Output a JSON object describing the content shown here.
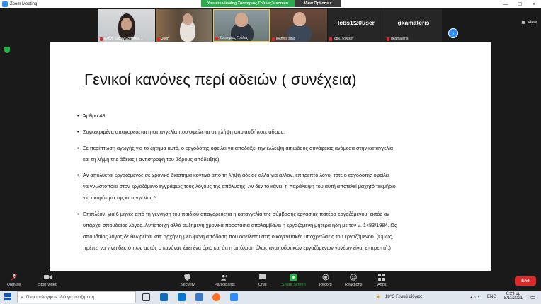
{
  "window": {
    "title": "Zoom Meeting"
  },
  "banner": {
    "viewing": "You are viewing Συστηριος Γούλας's screen",
    "view_options": "View Options"
  },
  "gallery": {
    "view_label": "View",
    "participants": [
      {
        "name": "Ελένη Ευαγγελοπούλο..."
      },
      {
        "name": "John"
      },
      {
        "name": "Συστηριος Γούλας"
      },
      {
        "name": "ioannis sinis"
      },
      {
        "name": "lcbs1!20user",
        "big": "lcbs1!20user"
      },
      {
        "name": "gkamateris",
        "big": "gkamateris"
      }
    ]
  },
  "slide": {
    "title": "Γενικοί κανόνες περί αδειών ( συνέχεια)",
    "bullets": [
      [
        "Άρθρο 48 :"
      ],
      [
        "Συγκεκριμένα απαγορεύεται η καταγγελία που οφείλεται στη λήψη οποιασδήποτε άδειας."
      ],
      [
        "Σε περίπτωση αγωγής για το ζήτημα αυτό, ο εργοδότης οφείλει να αποδείξει την έλλειψη αιτιώδους συνάφειας ανάμεσα στην καταγγελία",
        "και τη λήψη της άδειας ( αντιστροφή του βάρους απόδειξης)."
      ],
      [
        "Αν απολύεται εργαζόμενος σε χρονικό διάστημα κοντινό από τη λήψη άδειας αλλά για άλλον, επιτρεπτό λόγο, τότε ο εργοδότης οφείλει",
        "να γνωστοποιεί στον εργαζόμενο εγγράφως τους λόγους της απόλυσης. Αν δεν το κάνει, η παράλειψη του αυτή αποτελεί μαχητό τεκμήριο",
        "για ακυρότητα της καταγγελίας.*"
      ],
      [
        "Επιπλέον, για 6 μήνες από τη γέννηση του παιδιού απαγορεύεται η καταγγελία της σύμβασης εργασίας πατέρα-εργαζόμενου, εκτός αν",
        "υπάρχει σπουδαίος λόγος. Αντίστοιχη αλλά αυξημένη χρονικά προστασία απολαμβάνει η εργαζόμενη μητέρα ήδη με τον ν. 1483/1984. Ως",
        "σπουδαίος λόγος δε θεωρείται κατ' αρχήν η μειωμένη απόδοση που οφείλεται στις οικογενειακές υποχρεώσεις του εργαζόμενου. (Όμως,",
        "πρέπει να γίνει δεκτό πως αυτός ο κανόνας έχει ένα όριο και ότι η απόλυση όλως αναποδοτικών εργαζόμενων γονέων είναι επιτρεπτή.)"
      ]
    ]
  },
  "toolbar": {
    "unmute": "Unmute",
    "stop_video": "Stop Video",
    "security": "Security",
    "participants": "Participants",
    "participants_count": "9",
    "chat": "Chat",
    "share_screen": "Share Screen",
    "record": "Record",
    "reactions": "Reactions",
    "apps": "Apps",
    "end": "End"
  },
  "taskbar": {
    "search_placeholder": "Πληκτρολογήστε εδώ για αναζήτηση",
    "weather": "18°C  Γενικά αίθριος",
    "lang": "ENG",
    "time": "6:29 μμ",
    "date": "8/11/2021"
  },
  "colors": {
    "accent": "#2d8cff",
    "share_green": "#23b045",
    "end_red": "#e02828"
  }
}
